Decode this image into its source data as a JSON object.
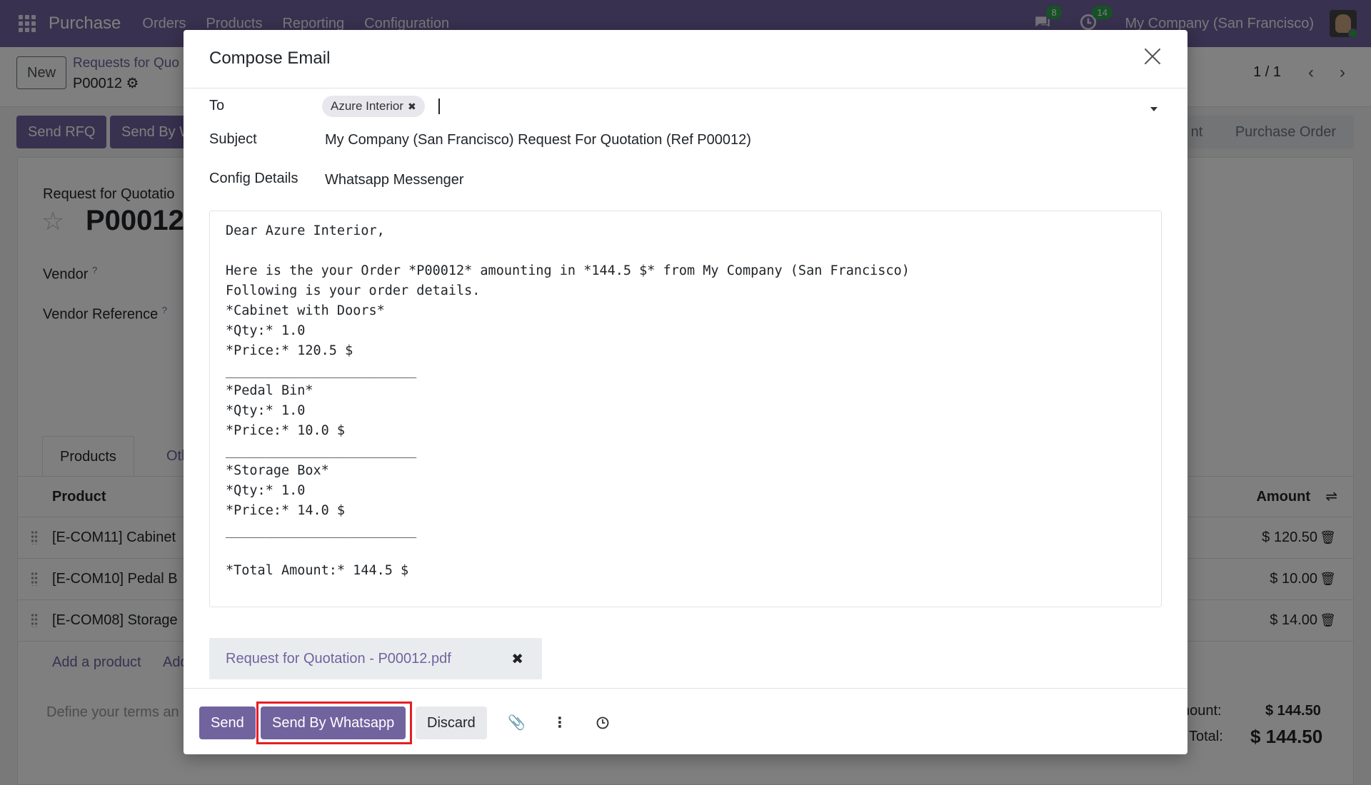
{
  "navbar": {
    "app_name": "Purchase",
    "menu": [
      "Orders",
      "Products",
      "Reporting",
      "Configuration"
    ],
    "messages_count": "8",
    "activities_count": "14",
    "company": "My Company (San Francisco)"
  },
  "control": {
    "new_label": "New",
    "breadcrumb": "Requests for Quo",
    "record": "P00012",
    "pager": "1 / 1"
  },
  "actionbar": {
    "send_rfq": "Send RFQ",
    "send_by": "Send By W",
    "status_partial": "nt",
    "status_current": "Purchase Order"
  },
  "form": {
    "doc_type": "Request for Quotatio",
    "doc_number": "P00012",
    "vendor_label": "Vendor",
    "vendor_ref_label": "Vendor Reference",
    "help_mark": "?",
    "tabs": [
      "Products",
      "Othe"
    ],
    "col_product": "Product",
    "col_amount": "Amount",
    "rows": [
      {
        "product": "[E-COM11] Cabinet",
        "amount": "$ 120.50"
      },
      {
        "product": "[E-COM10] Pedal B",
        "amount": "$ 10.00"
      },
      {
        "product": "[E-COM08] Storage",
        "amount": "$ 14.00"
      }
    ],
    "add_product": "Add a product",
    "add_other": "Add",
    "terms_placeholder": "Define your terms an",
    "untaxed_label": "nount:",
    "untaxed_value": "$ 144.50",
    "total_label": "Total:",
    "total_value": "$ 144.50"
  },
  "modal": {
    "title": "Compose Email",
    "to_label": "To",
    "to_tag": "Azure Interior",
    "tag_remove": "✖",
    "subject_label": "Subject",
    "subject_value": "My Company (San Francisco) Request For Quotation (Ref P00012)",
    "config_label": "Config Details",
    "config_value": "Whatsapp Messenger",
    "body_lines": [
      "Dear Azure Interior,",
      "",
      "Here is the your Order *P00012* amounting in *144.5 $* from My Company (San Francisco)",
      "Following is your order details.",
      "*Cabinet with Doors*",
      "*Qty:* 1.0",
      "*Price:* 120.5 $",
      "________________________",
      "*Pedal Bin*",
      "*Qty:* 1.0",
      "*Price:* 10.0 $",
      "________________________",
      "*Storage Box*",
      "*Qty:* 1.0",
      "*Price:* 14.0 $",
      "________________________",
      "",
      "*Total Amount:* 144.5 $"
    ],
    "attachment": "Request for Quotation - P00012.pdf",
    "attachment_remove": "✖",
    "send_label": "Send",
    "send_whatsapp_label": "Send By Whatsapp",
    "discard_label": "Discard"
  },
  "colors": {
    "brand": "#71639e",
    "highlight": "#e41e24",
    "badge": "#2ea44f"
  },
  "icons": {
    "apps": "apps-icon",
    "messages": "chat-icon",
    "activities": "clock-icon",
    "close": "close-icon",
    "attach": "paperclip-icon",
    "more": "kebab-icon",
    "schedule": "clock-icon",
    "trash": "trash-icon",
    "settings": "gear-icon",
    "star": "star-icon",
    "columns": "sliders-icon"
  }
}
